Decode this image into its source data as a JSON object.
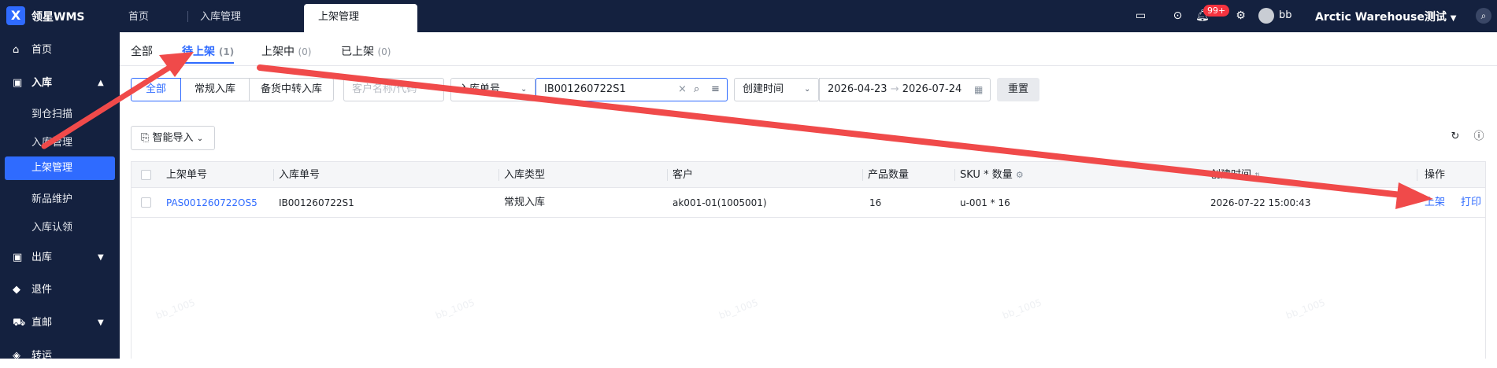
{
  "app": {
    "logo_glyph": "X",
    "brand": "领星WMS"
  },
  "nav_tabs": [
    {
      "label": "首页"
    },
    {
      "label": "入库管理"
    },
    {
      "label": "上架管理"
    }
  ],
  "topbar": {
    "badge": "99+",
    "user": "bb",
    "warehouse": "Arctic Warehouse测试",
    "icons": [
      "inbox-icon",
      "download-icon",
      "bell-icon",
      "settings-icon",
      "avatar",
      "search-icon"
    ]
  },
  "sidebar": {
    "home": "首页",
    "inbound": "入库",
    "inbound_children": [
      "到仓扫描",
      "入库管理",
      "上架管理",
      "新品维护",
      "入库认领"
    ],
    "outbound": "出库",
    "returns": "退件",
    "direct": "直邮",
    "transfer": "转运"
  },
  "status_tabs": [
    {
      "label": "全部",
      "count": ""
    },
    {
      "label": "待上架",
      "count": "(1)"
    },
    {
      "label": "上架中",
      "count": "(0)"
    },
    {
      "label": "已上架",
      "count": "(0)"
    }
  ],
  "filters": {
    "type_buttons": [
      "全部",
      "常规入库",
      "备货中转入库"
    ],
    "customer_placeholder": "客户名称/代码",
    "order_select": "入库单号",
    "order_value": "IB001260722S1",
    "time_select": "创建时间",
    "date_from": "2026-04-23",
    "date_to": "2026-07-24",
    "reset": "重置"
  },
  "toolbar": {
    "import": "智能导入"
  },
  "table": {
    "headers": [
      "上架单号",
      "入库单号",
      "入库类型",
      "客户",
      "产品数量",
      "SKU * 数量",
      "创建时间",
      "操作"
    ],
    "rows": [
      {
        "putaway_no": "PAS001260722OS5",
        "inbound_no": "IB001260722S1",
        "inbound_type": "常规入库",
        "customer": "ak001-01(1005001)",
        "qty": "16",
        "sku_qty": "u-001 * 16",
        "created": "2026-07-22 15:00:43",
        "action_putaway": "上架",
        "action_print": "打印"
      }
    ]
  },
  "watermark": "bb_1005",
  "colors": {
    "primary": "#2f6bff",
    "nav_bg": "#14213f",
    "annotation_arrow": "#f04a4a"
  }
}
